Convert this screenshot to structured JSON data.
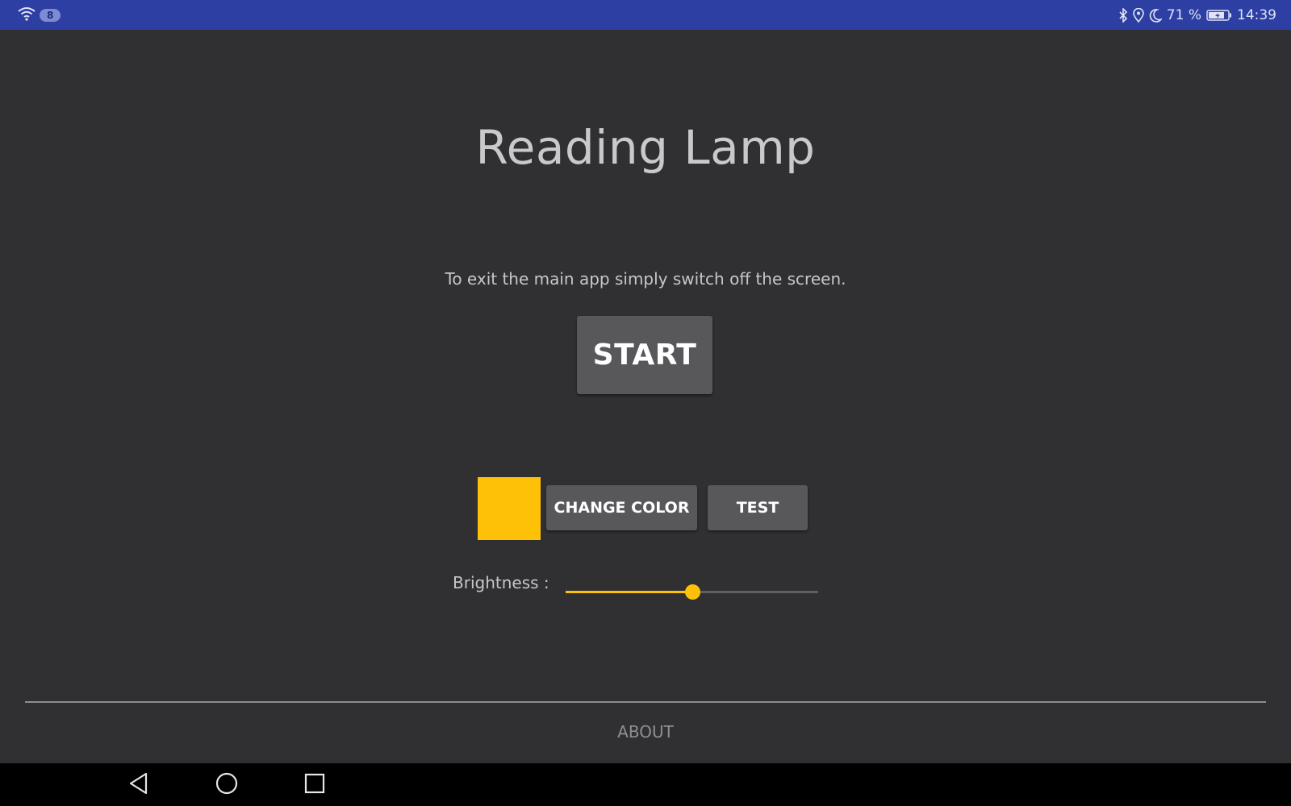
{
  "status_bar": {
    "notification_count": "8",
    "battery_percent": "71 %",
    "time": "14:39",
    "icons": [
      "wifi-icon",
      "bluetooth-icon",
      "location-icon",
      "do-not-disturb-moon-icon",
      "battery-charging-icon"
    ]
  },
  "app": {
    "title": "Reading Lamp",
    "hint": "To exit the main app simply switch off the screen.",
    "start_label": "START",
    "color_swatch": "#ffc107",
    "change_color_label": "CHANGE COLOR",
    "test_label": "TEST",
    "brightness_label": "Brightness :",
    "brightness_level_percent": 50,
    "accent_color": "#ffc107",
    "about_label": "ABOUT"
  },
  "nav_bar": {
    "icons": [
      "back-icon",
      "home-icon",
      "recents-icon"
    ]
  }
}
